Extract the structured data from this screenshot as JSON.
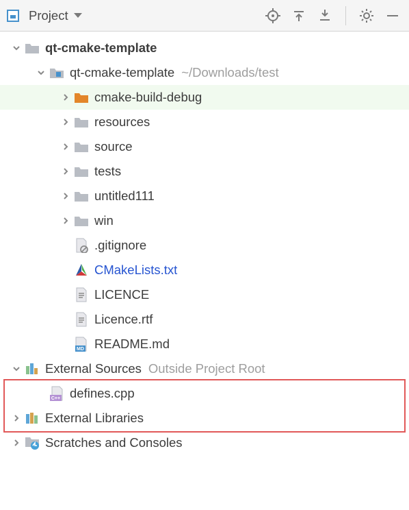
{
  "toolbar": {
    "title": "Project"
  },
  "tree": {
    "root": {
      "label": "qt-cmake-template"
    },
    "module": {
      "label": "qt-cmake-template",
      "path": "~/Downloads/test"
    },
    "dirs": {
      "cmake_build_debug": "cmake-build-debug",
      "resources": "resources",
      "source": "source",
      "tests": "tests",
      "untitled": "untitled111",
      "win": "win"
    },
    "files": {
      "gitignore": ".gitignore",
      "cmakelists": "CMakeLists.txt",
      "licence": "LICENCE",
      "licence_rtf": "Licence.rtf",
      "readme": "README.md"
    },
    "external_sources": {
      "label": "External Sources",
      "hint": "Outside Project Root",
      "file": "defines.cpp"
    },
    "external_libraries": "External Libraries",
    "scratches": "Scratches and Consoles"
  }
}
